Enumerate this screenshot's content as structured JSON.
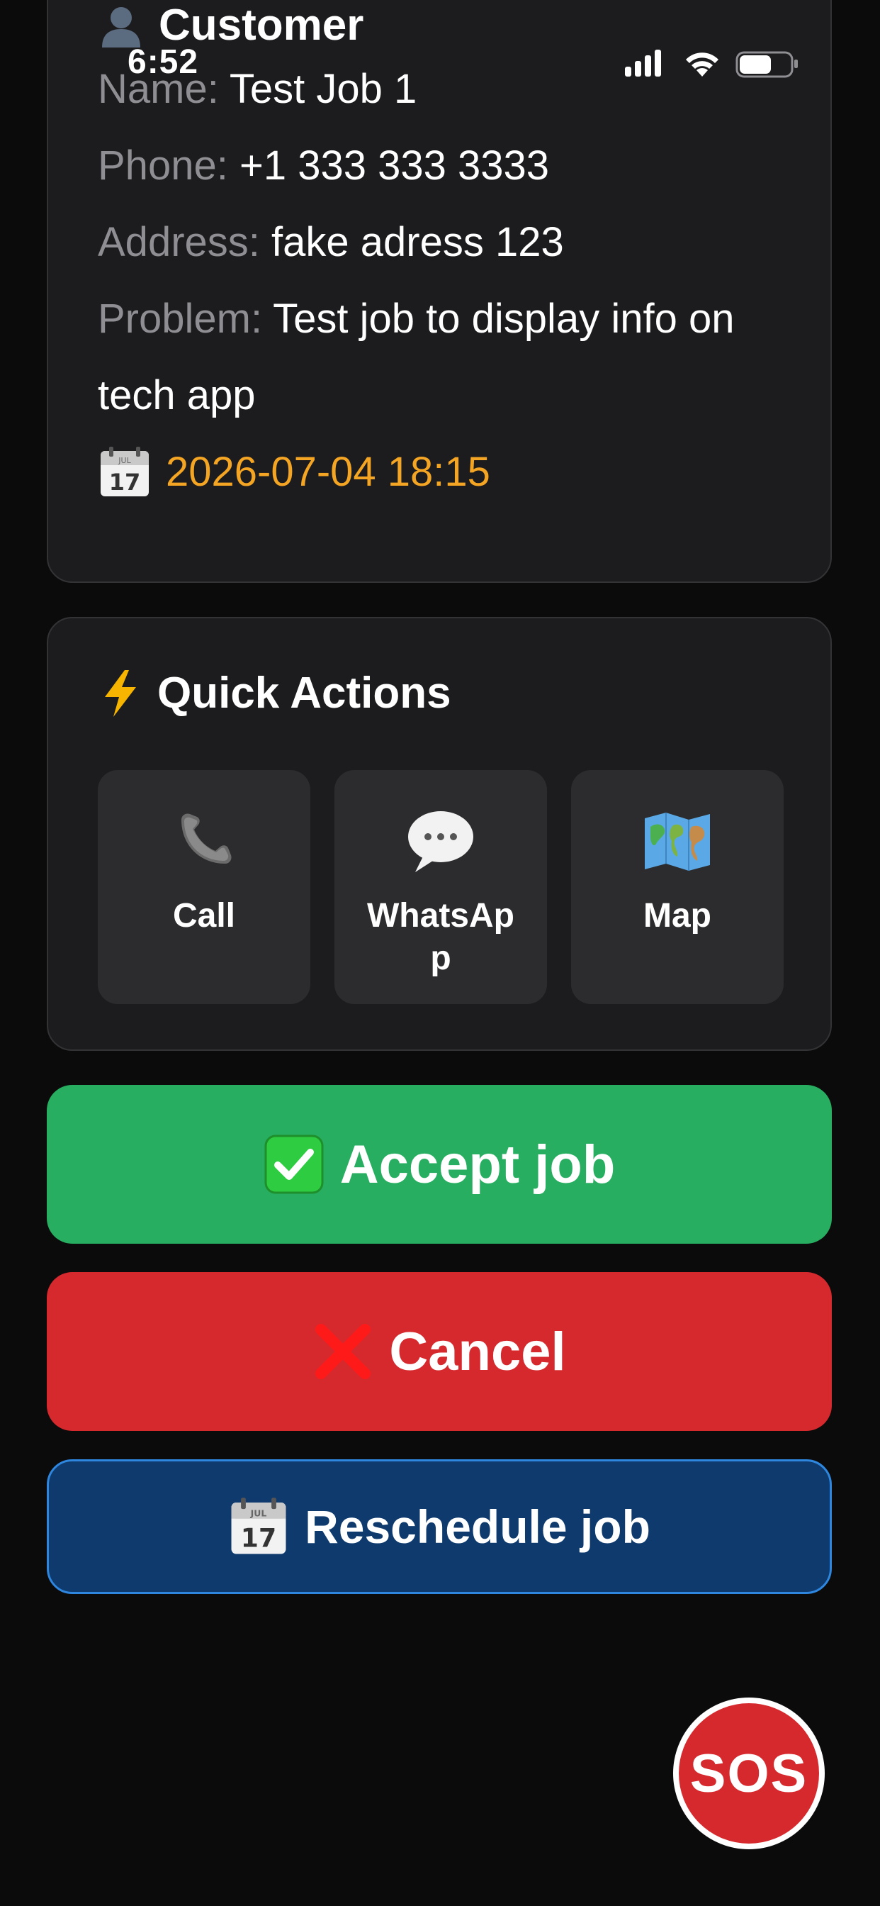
{
  "status_bar": {
    "time": "6:52",
    "icons": [
      "cellular-signal-icon",
      "wifi-icon",
      "battery-icon"
    ]
  },
  "customer_card": {
    "icon": "person-silhouette-icon",
    "title": "Customer",
    "name_label": "Name:",
    "name_value": "Test Job 1",
    "phone_label": "Phone:",
    "phone_value": "+1 333 333 3333",
    "address_label": "Address:",
    "address_value": "fake adress 123",
    "problem_label": "Problem:",
    "problem_value": "Test job to display info on tech app",
    "date_icon": "calendar-icon",
    "date_value": "2026-07-04 18:15"
  },
  "quick_actions": {
    "icon": "lightning-icon",
    "title": "Quick Actions",
    "tiles": [
      {
        "label": "Call",
        "icon": "phone-icon"
      },
      {
        "label": "WhatsApp",
        "icon": "speech-bubble-icon"
      },
      {
        "label": "Map",
        "icon": "world-map-icon"
      }
    ]
  },
  "actions": {
    "accept_label": "Accept job",
    "accept_icon": "check-mark-icon",
    "cancel_label": "Cancel",
    "cancel_icon": "cross-mark-icon",
    "reschedule_label": "Reschedule job",
    "reschedule_icon": "calendar-icon"
  },
  "sos": {
    "label": "SOS"
  },
  "colors": {
    "background": "#0b0b0b",
    "card": "#1c1c1e",
    "tile": "#2c2c2e",
    "label_gray": "#8e8e93",
    "date_orange": "#f5a524",
    "accept_green": "#27ae60",
    "cancel_red": "#d6292d",
    "reschedule_blue": "#0e3a6d",
    "reschedule_border": "#2e86de"
  }
}
